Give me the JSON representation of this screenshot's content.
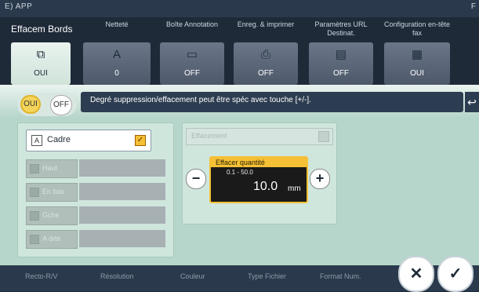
{
  "app": {
    "title": "E) APP",
    "right_label": "F"
  },
  "tabs": [
    {
      "title": "Effacem Bords",
      "value": "OUI",
      "icon": "erase-border-icon"
    },
    {
      "title": "Netteté",
      "value": "0",
      "icon": "sharpness-icon"
    },
    {
      "title": "Boîte Annotation",
      "value": "OFF",
      "icon": "annotation-box-icon"
    },
    {
      "title": "Enreg. & imprimer",
      "value": "OFF",
      "icon": "save-print-icon"
    },
    {
      "title": "Paramètres URL Destinat.",
      "value": "OFF",
      "icon": "url-destination-icon"
    },
    {
      "title": "Configuration en-tête fax",
      "value": "OUI",
      "icon": "fax-header-icon"
    }
  ],
  "toggle": {
    "on_label": "OUI",
    "off_label": "OFF",
    "selected": "OUI"
  },
  "message": "Degré suppression/effacement peut être spéc avec touche [+/-].",
  "frame": {
    "cadre_label": "Cadre",
    "cadre_checked": true,
    "sides": [
      {
        "label": "Haut"
      },
      {
        "label": "En bas"
      },
      {
        "label": "Gche"
      },
      {
        "label": "A drte"
      }
    ]
  },
  "erase": {
    "select_label": "Effacement",
    "quantity_title": "Effacer quantité",
    "range": "0.1 - 50.0",
    "value": "10.0",
    "unit": "mm"
  },
  "bottom_bar": [
    "Recto-R/V",
    "Résolution",
    "Couleur",
    "Type Fichier",
    "Format Num."
  ],
  "actions": {
    "cancel": "✕",
    "ok": "✓"
  }
}
